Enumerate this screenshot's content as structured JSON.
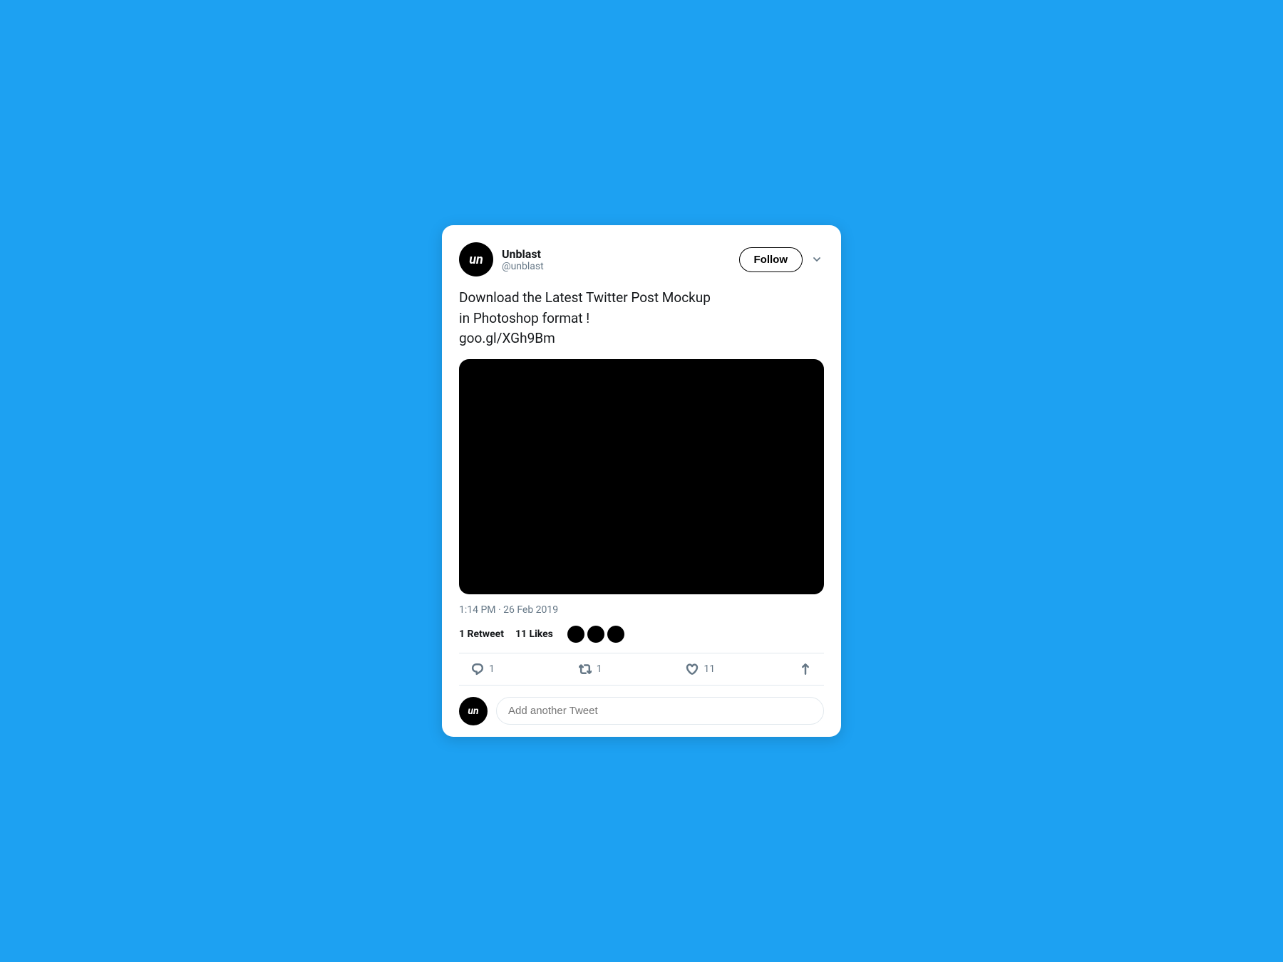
{
  "page": {
    "background_color": "#1DA1F2"
  },
  "tweet": {
    "user": {
      "display_name": "Unblast",
      "handle": "@unblast",
      "avatar_text": "un"
    },
    "follow_button_label": "Follow",
    "text_line1": "Download the Latest Twitter Post Mockup",
    "text_line2": "in Photoshop format !",
    "text_line3": "goo.gl/XGh9Bm",
    "timestamp": "1:14 PM · 26 Feb 2019",
    "stats": {
      "retweet_count": "1",
      "retweet_label": "Retweet",
      "like_count": "11",
      "like_label": "Likes"
    },
    "actions": {
      "reply_count": "1",
      "retweet_count": "1",
      "like_count": "11"
    },
    "compose": {
      "placeholder": "Add another Tweet",
      "avatar_text": "un"
    }
  }
}
